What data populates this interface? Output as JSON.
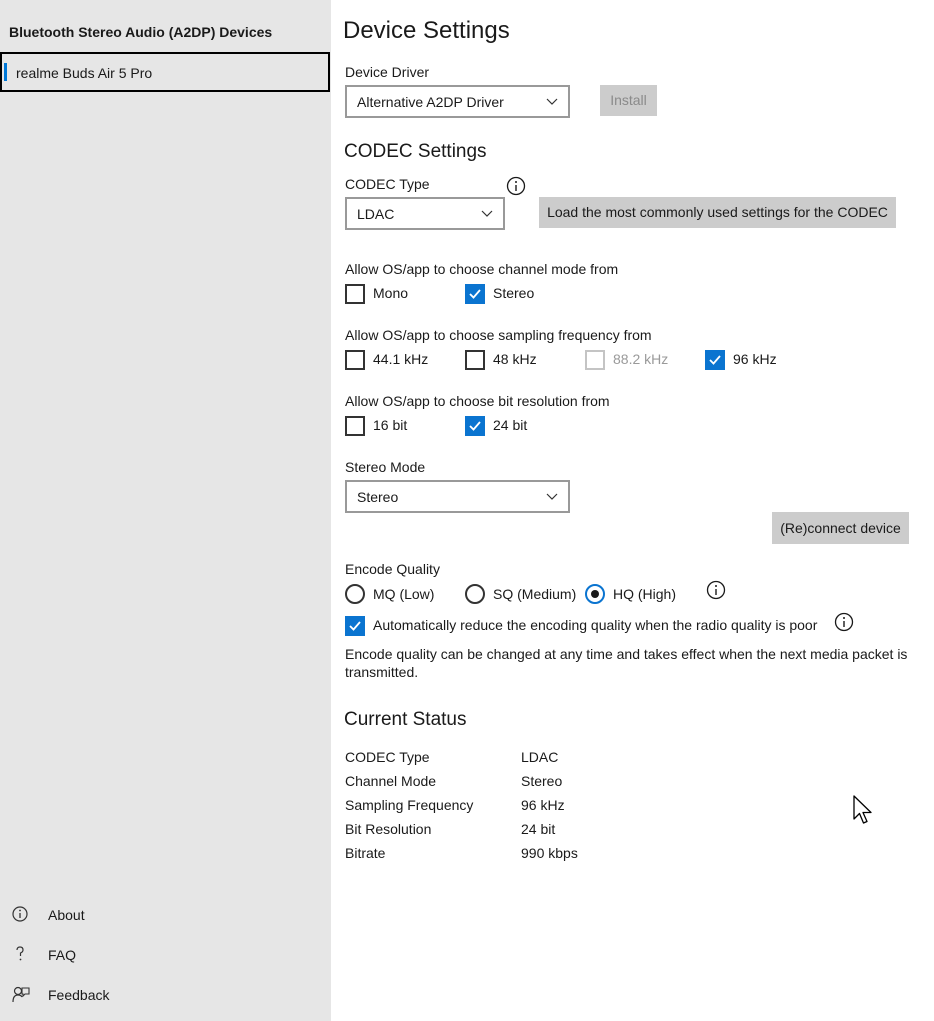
{
  "sidebar": {
    "title": "Bluetooth Stereo Audio (A2DP) Devices",
    "selected_device": "realme Buds Air 5 Pro",
    "footer": {
      "about": "About",
      "faq": "FAQ",
      "feedback": "Feedback"
    }
  },
  "main": {
    "title": "Device Settings",
    "device_driver": {
      "label": "Device Driver",
      "selected": "Alternative A2DP Driver",
      "install_button": "Install"
    },
    "codec_settings": {
      "heading": "CODEC Settings",
      "codec_type_label": "CODEC Type",
      "codec_type_selected": "LDAC",
      "load_defaults_button": "Load the most commonly used settings for the CODEC",
      "channel_mode": {
        "label": "Allow OS/app to choose channel mode from",
        "mono": "Mono",
        "stereo": "Stereo"
      },
      "sampling": {
        "label": "Allow OS/app to choose sampling frequency from",
        "f44": "44.1 kHz",
        "f48": "48 kHz",
        "f88": "88.2 kHz",
        "f96": "96 kHz"
      },
      "bit_resolution": {
        "label": "Allow OS/app to choose bit resolution from",
        "b16": "16 bit",
        "b24": "24 bit"
      },
      "stereo_mode": {
        "label": "Stereo Mode",
        "selected": "Stereo"
      },
      "reconnect_button": "(Re)connect device",
      "encode_quality": {
        "label": "Encode Quality",
        "mq": "MQ (Low)",
        "sq": "SQ (Medium)",
        "hq": "HQ (High)",
        "auto_reduce": "Automatically reduce the encoding quality when the radio quality is poor",
        "note": "Encode quality can be changed at any time and takes effect when the next media packet is transmitted."
      }
    },
    "current_status": {
      "heading": "Current Status",
      "rows": [
        {
          "key": "CODEC Type",
          "value": "LDAC"
        },
        {
          "key": "Channel Mode",
          "value": "Stereo"
        },
        {
          "key": "Sampling Frequency",
          "value": "96 kHz"
        },
        {
          "key": "Bit Resolution",
          "value": "24 bit"
        },
        {
          "key": "Bitrate",
          "value": "990 kbps"
        }
      ]
    }
  },
  "state": {
    "mono": false,
    "stereo": true,
    "f44": false,
    "f48": false,
    "f88": "disabled",
    "f96": true,
    "b16": false,
    "b24": true,
    "encode_quality": "HQ (High)",
    "auto_reduce": true
  },
  "colors": {
    "accent": "#0a74d0",
    "sidebar_bg": "#e6e6e6",
    "button_bg": "#cccccc"
  },
  "icons": {
    "about": "info-icon",
    "faq": "question-icon",
    "feedback": "feedback-icon",
    "dropdown": "chevron-down-icon",
    "info": "info-icon",
    "check": "checkmark-icon",
    "cursor": "mouse-pointer-icon"
  }
}
